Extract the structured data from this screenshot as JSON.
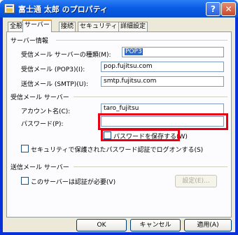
{
  "window": {
    "title": "富士通 太郎 のプロパティ",
    "help_label": "?",
    "close_label": "✕"
  },
  "tabs": [
    {
      "label": "全般"
    },
    {
      "label": "サーバー"
    },
    {
      "label": "接続"
    },
    {
      "label": "セキュリティ"
    },
    {
      "label": "詳細設定"
    }
  ],
  "server_info": {
    "heading": "サーバー情報",
    "incoming_type_label": "受信メール サーバーの種類(M):",
    "incoming_type_value": "POP3",
    "incoming_pop3_label": "受信メール (POP3)(I):",
    "incoming_pop3_value": "pop.fujitsu.com",
    "outgoing_smtp_label": "送信メール (SMTP)(U):",
    "outgoing_smtp_value": "smtp.fujitsu.com"
  },
  "incoming_server": {
    "heading": "受信メール サーバー",
    "account_label": "アカウント名(C):",
    "account_value": "taro_fujitsu",
    "password_label": "パスワード(P):",
    "password_value": "",
    "save_password_label": "パスワードを保存する(W)",
    "save_password_checked": false,
    "spa_label": "セキュリティで保護されたパスワード認証でログオンする(S)",
    "spa_checked": false
  },
  "outgoing_server": {
    "heading": "送信メール サーバー",
    "auth_required_label": "このサーバーは認証が必要(V)",
    "auth_required_checked": false,
    "settings_button": "設定(E)..."
  },
  "footer": {
    "ok": "OK",
    "cancel": "キャンセル",
    "apply": "適用(A)"
  },
  "colors": {
    "highlight": "#e60012",
    "titlebar": "#0553d9"
  }
}
